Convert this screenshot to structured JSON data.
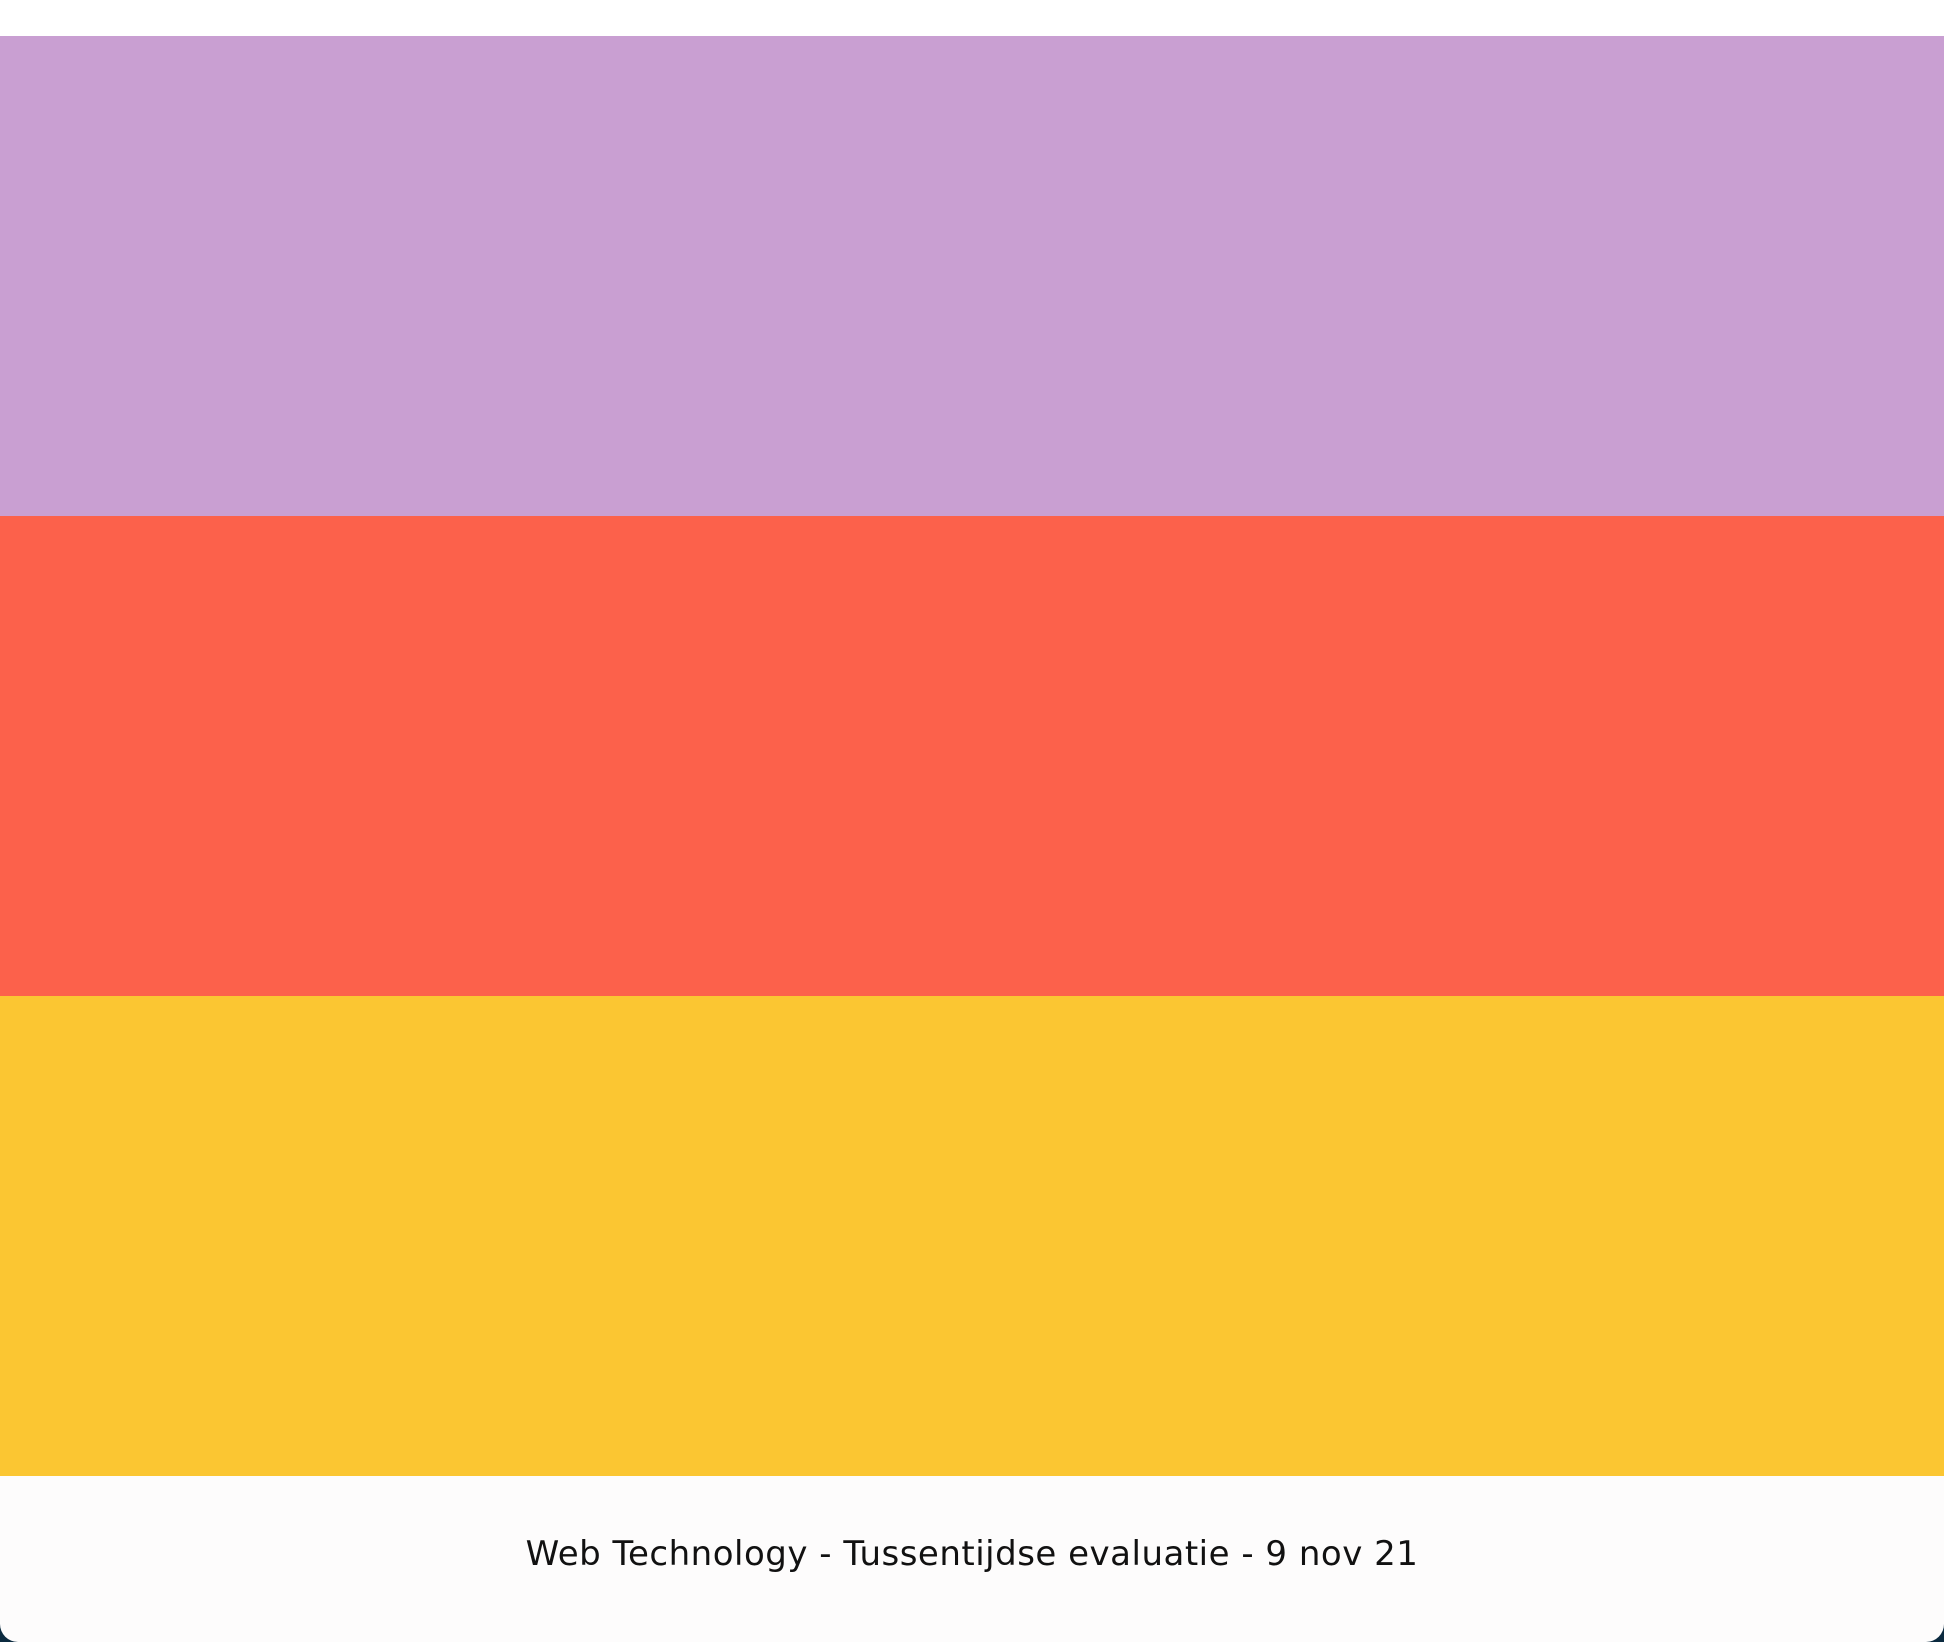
{
  "colors": {
    "band_1": "#c99fd2",
    "band_2": "#fc614b",
    "band_3": "#fbc632",
    "footer_background": "#fdfcfc",
    "footer_text": "#111111"
  },
  "footer": {
    "caption": "Web Technology - Tussentijdse evaluatie - 9 nov 21"
  }
}
